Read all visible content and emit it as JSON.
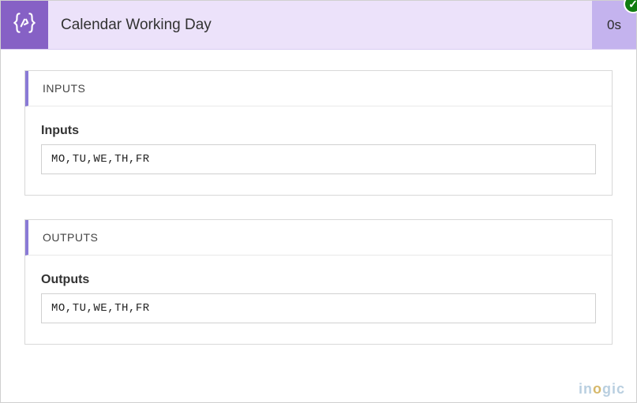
{
  "header": {
    "title": "Calendar Working Day",
    "duration": "0s",
    "icon": "compose-braces-icon",
    "status": "success"
  },
  "inputs": {
    "section_label": "INPUTS",
    "field_label": "Inputs",
    "value": "MO,TU,WE,TH,FR"
  },
  "outputs": {
    "section_label": "OUTPUTS",
    "field_label": "Outputs",
    "value": "MO,TU,WE,TH,FR"
  },
  "watermark": {
    "pre": "in",
    "accent": "o",
    "post": "gic"
  }
}
